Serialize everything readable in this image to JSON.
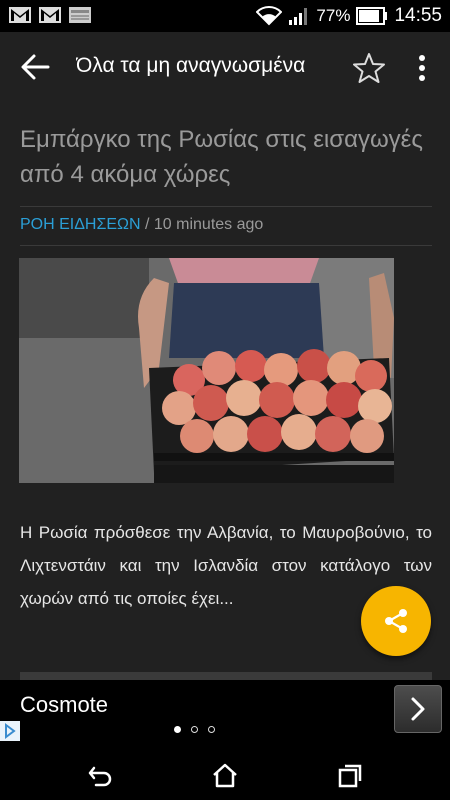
{
  "status_bar": {
    "battery": "77%",
    "time": "14:55",
    "icons": [
      "gmail-icon",
      "gmail-icon",
      "image-notification-icon",
      "wifi-icon",
      "signal-icon",
      "battery-icon"
    ]
  },
  "app_bar": {
    "title": "Όλα τα μη αναγνωσμένα",
    "icons": [
      "back-arrow-icon",
      "star-icon",
      "more-vert-icon"
    ]
  },
  "article": {
    "headline": "Εμπάργκο της Ρωσίας στις εισαγωγές από 4 ακόμα χώρες",
    "category": "ΡΟΗ ΕΙΔΗΣΕΩΝ",
    "separator": " / ",
    "time": "10 minutes ago",
    "body": "Η Ρωσία πρόσθεσε την Αλβανία, το Μαυροβούνιο, το Λιχτενστάιν και την Ισλανδία στον κατάλογο των χωρών από τις οποίες έχει...",
    "image_alt": "crate of peaches held by a person"
  },
  "fab": {
    "icon": "share-icon",
    "color": "#f7b500"
  },
  "ad": {
    "brand": "Cosmote",
    "next_icon": "chevron-right-icon",
    "pager_dots": 3,
    "active_dot": 0
  },
  "nav_bar": {
    "icons": [
      "nav-back-icon",
      "nav-home-icon",
      "nav-recents-icon"
    ]
  },
  "colors": {
    "background": "#212121",
    "accent_link": "#2b9fd6",
    "fab": "#f7b500"
  }
}
